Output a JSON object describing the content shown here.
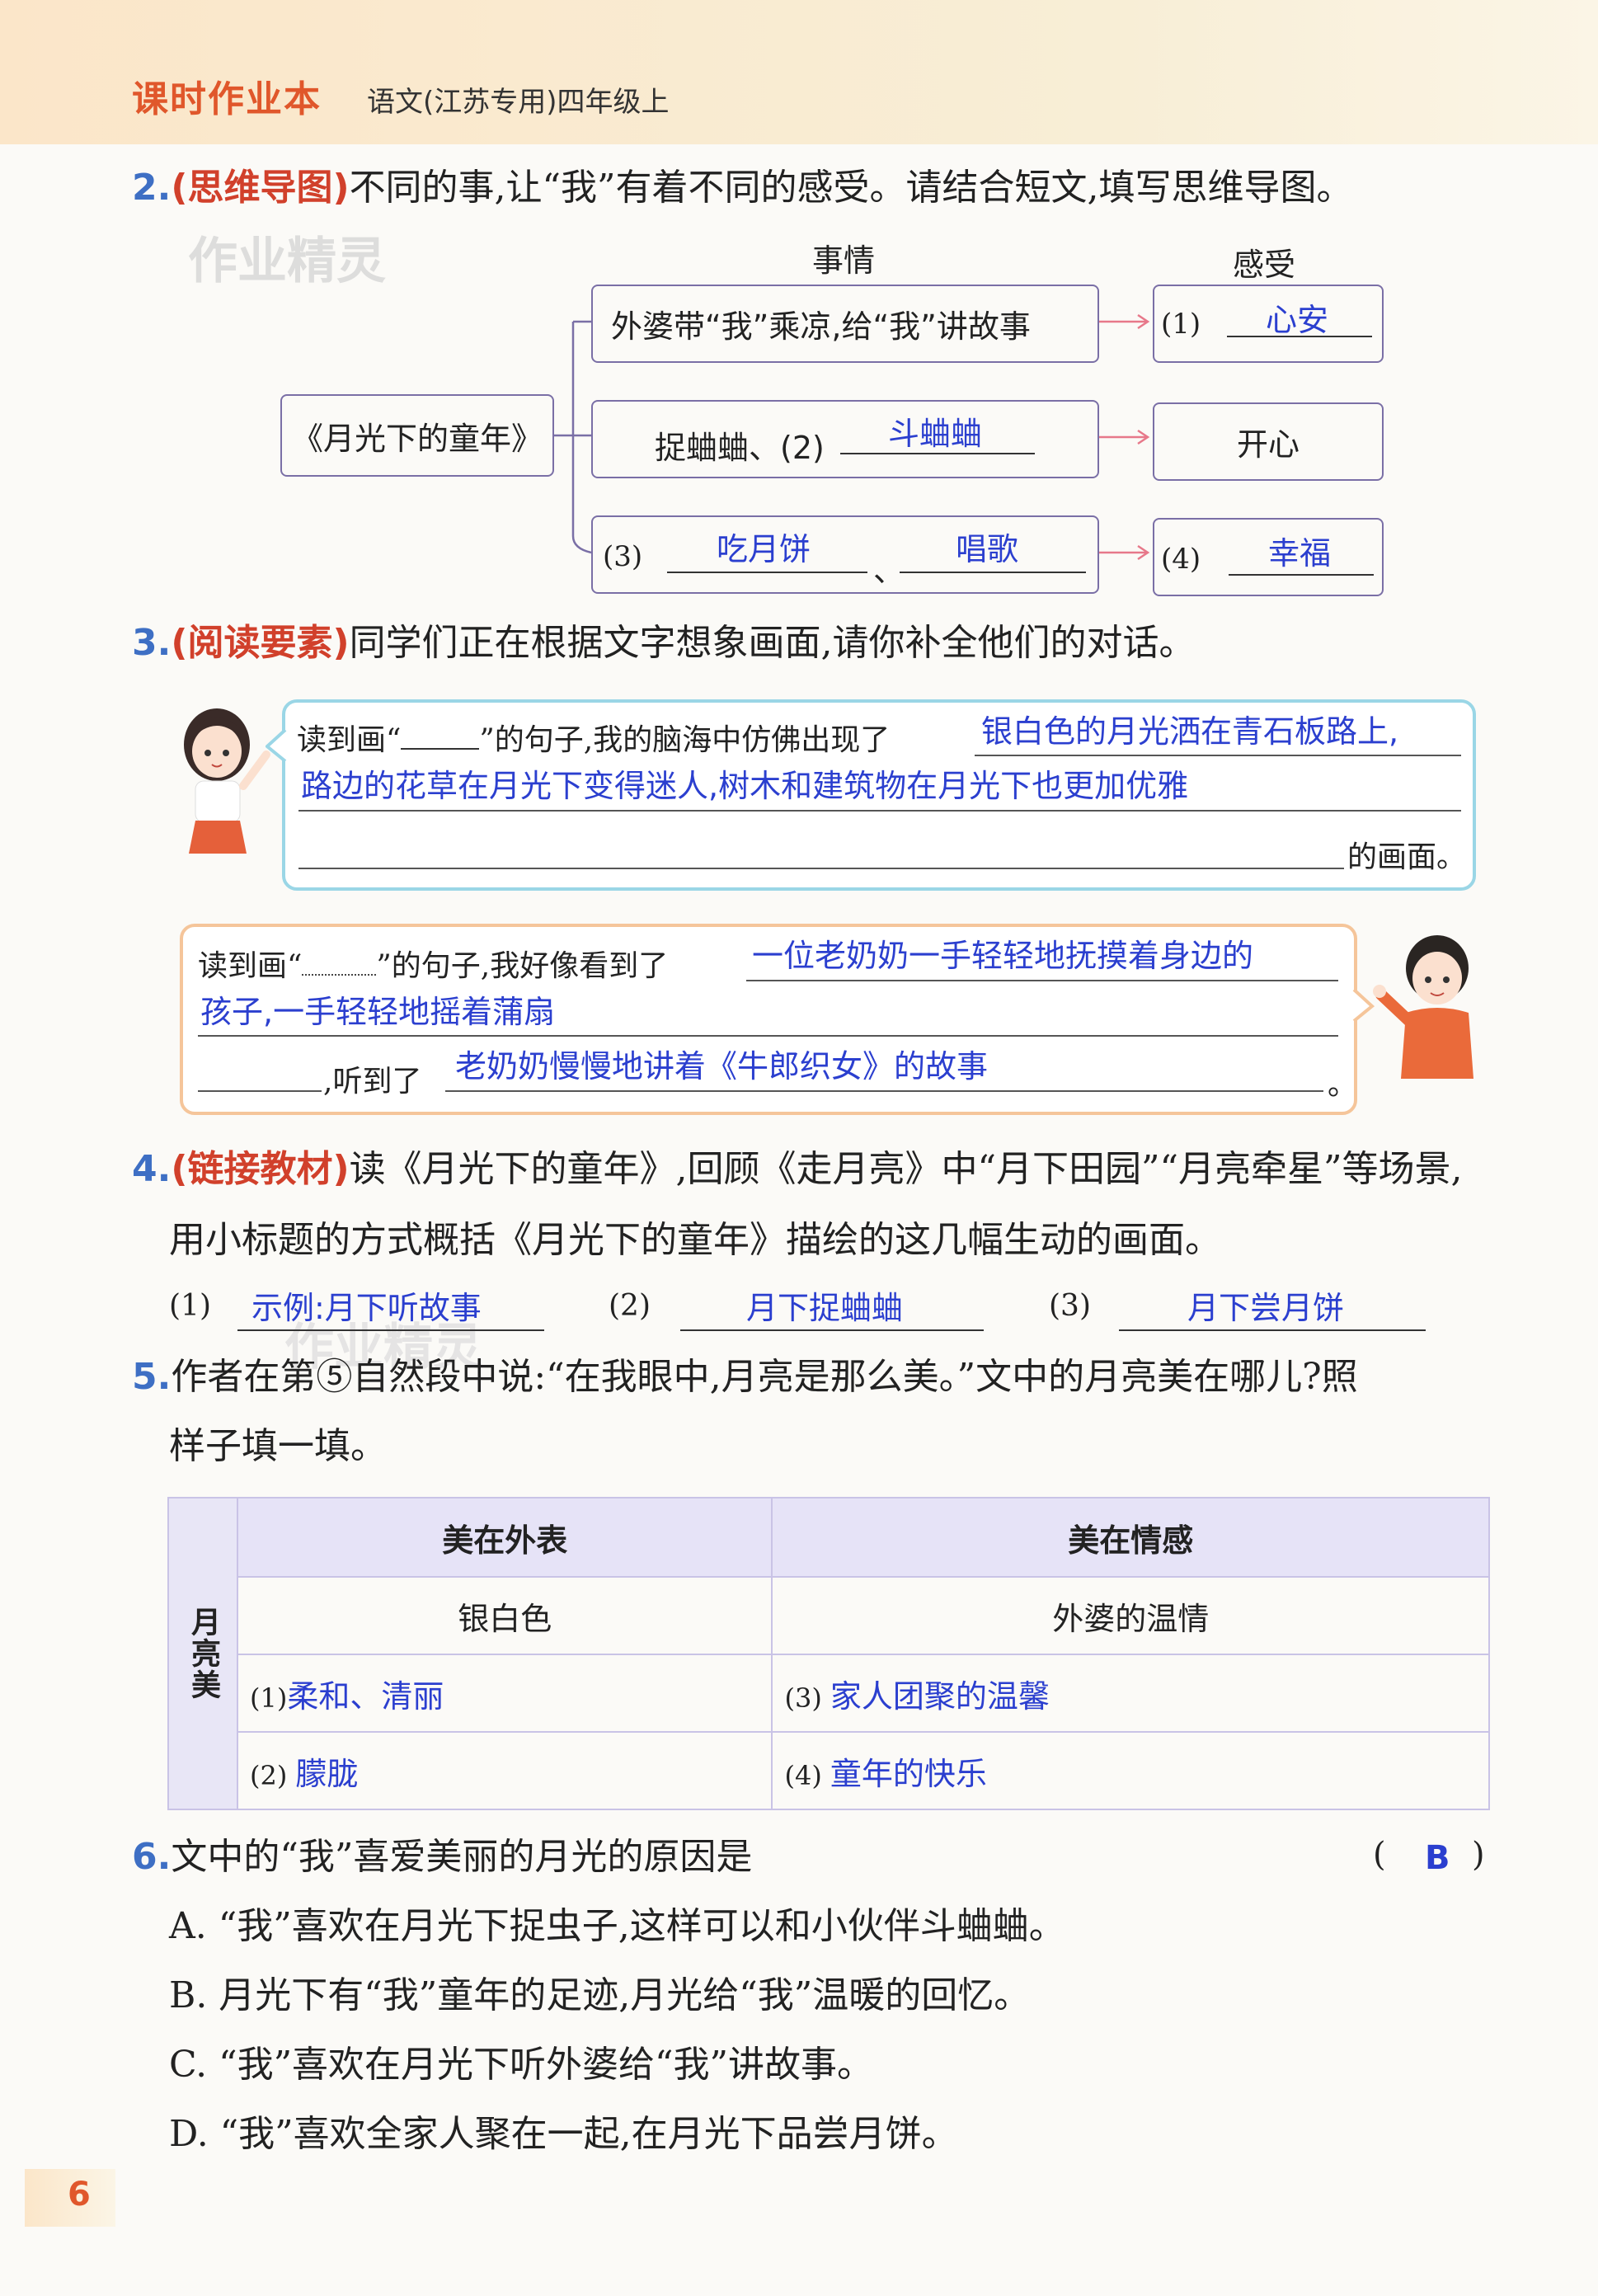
{
  "header": {
    "brand": "课时作业本",
    "subtitle": "语文(江苏专用)四年级上"
  },
  "watermark": "作业精灵",
  "q2": {
    "num": "2.",
    "tag": "(思维导图)",
    "text": "不同的事,让“我”有着不同的感受。请结合短文,填写思维导图。",
    "col_events": "事情",
    "col_feelings": "感受",
    "root": "《月光下的童年》",
    "row1_event": "外婆带“我”乘凉,给“我”讲故事",
    "row1_feel_label": "(1)",
    "row1_feel_answer": "心安",
    "row2_event_prefix": "捉蛐蛐、(2)",
    "row2_event_answer": "斗蛐蛐",
    "row2_feel": "开心",
    "row3_label": "(3)",
    "row3_answer_a": "吃月饼",
    "row3_sep": "、",
    "row3_answer_b": "唱歌",
    "row4_label": "(4)",
    "row4_answer": "幸福"
  },
  "q3": {
    "num": "3.",
    "tag": "(阅读要素)",
    "text": "同学们正在根据文字想象画面,请你补全他们的对话。",
    "girl_prefix_a": "读到画“",
    "girl_prefix_b": "”的句子,我的脑海中仿佛出现了",
    "girl_answer_1": "银白色的月光洒在青石板路上,",
    "girl_answer_2": "路边的花草在月光下变得迷人,树木和建筑物在月光下也更加优雅",
    "girl_suffix": "的画面。",
    "boy_prefix_a": "读到画“",
    "boy_prefix_b": "”的句子,我好像看到了",
    "boy_answer_1": "一位老奶奶一手轻轻地抚摸着身边的",
    "boy_answer_2": "孩子,一手轻轻地摇着蒲扇",
    "boy_mid": ",听到了",
    "boy_answer_3": "老奶奶慢慢地讲着《牛郎织女》的故事",
    "boy_end": "。"
  },
  "q4": {
    "num": "4.",
    "tag": "(链接教材)",
    "text1": "读《月光下的童年》,回顾《走月亮》中“月下田园”“月亮牵星”等场景,",
    "text2": "用小标题的方式概括《月光下的童年》描绘的这几幅生动的画面。",
    "a1_label": "(1)",
    "a1": "示例:月下听故事",
    "a2_label": "(2)",
    "a2": "月下捉蛐蛐",
    "a3_label": "(3)",
    "a3": "月下尝月饼"
  },
  "q5": {
    "num": "5.",
    "text1": "作者在第⑤自然段中说:“在我眼中,月亮是那么美。”文中的月亮美在哪儿?照",
    "text2": "样子填一填。",
    "side": "月亮美",
    "h1": "美在外表",
    "h2": "美在情感",
    "r1c1": "银白色",
    "r1c2": "外婆的温情",
    "r2c1_label": "(1)",
    "r2c1": "柔和、清丽",
    "r2c2_label": "(3)",
    "r2c2": "家人团聚的温馨",
    "r3c1_label": "(2)",
    "r3c1": "朦胧",
    "r3c2_label": "(4)",
    "r3c2": "童年的快乐"
  },
  "q6": {
    "num": "6.",
    "text": "文中的“我”喜爱美丽的月光的原因是",
    "paren_open": "(",
    "answer": "B",
    "paren_close": ")",
    "options": [
      "A. “我”喜欢在月光下捉虫子,这样可以和小伙伴斗蛐蛐。",
      "B. 月光下有“我”童年的足迹,月光给“我”温暖的回忆。",
      "C. “我”喜欢在月光下听外婆给“我”讲故事。",
      "D. “我”喜欢全家人聚在一起,在月光下品尝月饼。"
    ]
  },
  "page_number": "6"
}
